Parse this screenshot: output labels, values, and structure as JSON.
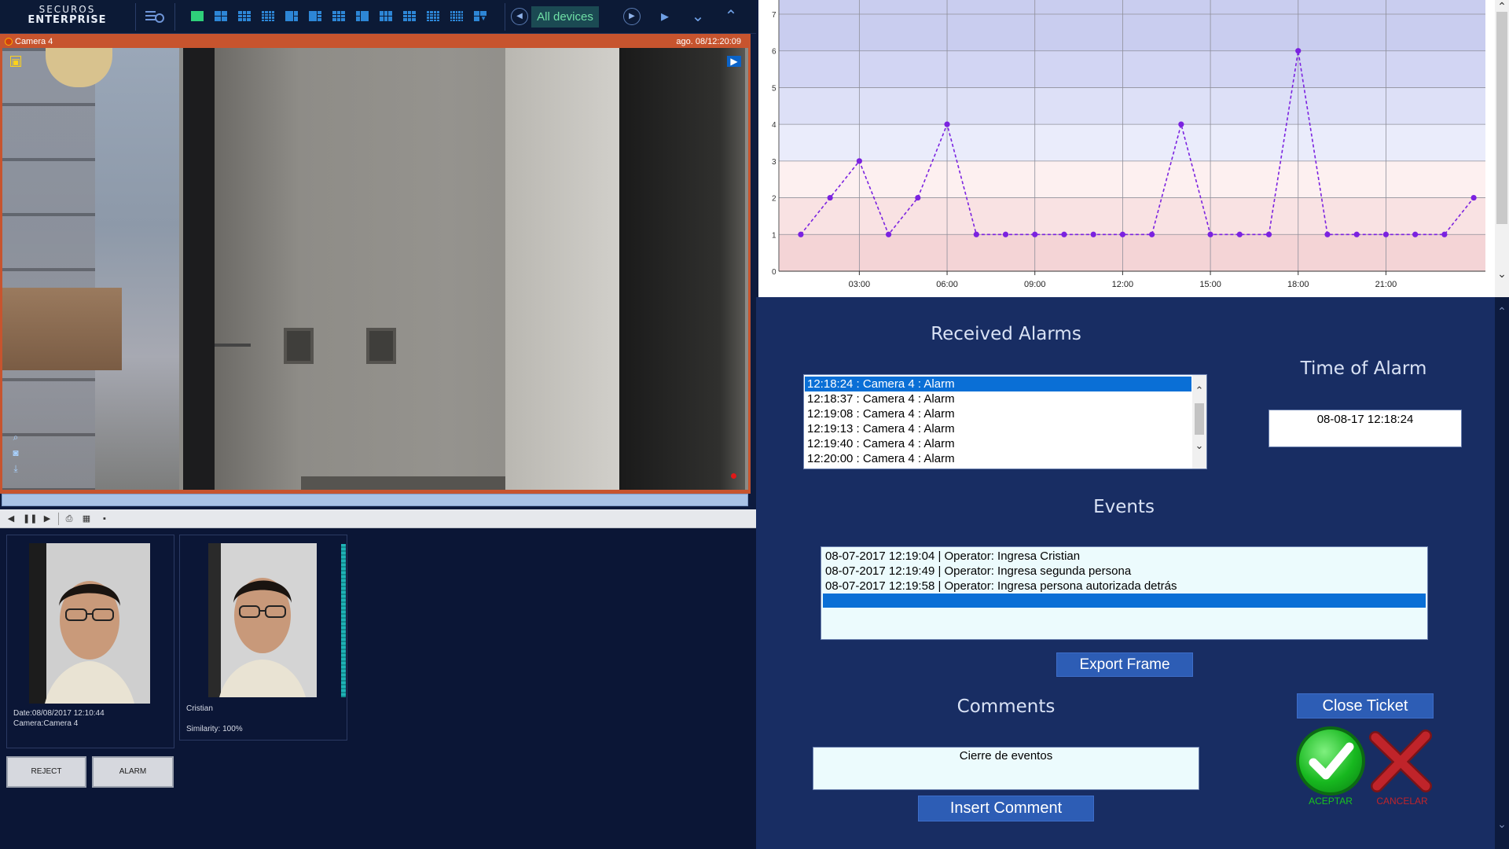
{
  "toolbar": {
    "brand_line1": "SECUROS",
    "brand_line2": "ENTERPRISE",
    "device_filter": "All devices"
  },
  "camera": {
    "name": "Camera 4",
    "timestamp": "ago. 08/12:20:09"
  },
  "face_results": {
    "detected": {
      "date": "Date:08/08/2017 12:10:44",
      "camera": "Camera:Camera 4"
    },
    "match": {
      "name": "Cristian",
      "similarity": "Similarity: 100%"
    },
    "reject_label": "REJECT",
    "alarm_label": "ALARM"
  },
  "chart_data": {
    "type": "line",
    "x_ticks": [
      "03:00",
      "06:00",
      "09:00",
      "12:00",
      "15:00",
      "18:00",
      "21:00"
    ],
    "y_ticks": [
      "0",
      "1",
      "2",
      "3",
      "4",
      "5",
      "6",
      "7"
    ],
    "ylim": [
      0,
      7
    ],
    "xlim_hours": [
      0.25,
      24.4
    ],
    "grid": true,
    "line_color": "#7b22e0",
    "band_colors": [
      "#f4d4d6",
      "#f9e2e3",
      "#fdf0f0",
      "#eaecfb",
      "#dde0f7",
      "#d2d5f3",
      "#c9cdef"
    ],
    "series": [
      {
        "x_hours": [
          1,
          2,
          3,
          4,
          5,
          6,
          7,
          8,
          9,
          10,
          11,
          12,
          13,
          14,
          15,
          16,
          17,
          18,
          19,
          20,
          21,
          22,
          23,
          24
        ],
        "values": [
          1,
          2,
          3,
          1,
          2,
          4,
          1,
          1,
          1,
          1,
          1,
          1,
          1,
          4,
          1,
          1,
          1,
          6,
          1,
          1,
          1,
          1,
          1,
          2
        ]
      }
    ]
  },
  "alarms": {
    "heading": "Received Alarms",
    "items": [
      "12:18:24 : Camera 4 : Alarm",
      "12:18:37 : Camera 4 : Alarm",
      "12:19:08 : Camera 4 : Alarm",
      "12:19:13 : Camera 4 : Alarm",
      "12:19:40 : Camera 4 : Alarm",
      "12:20:00 : Camera 4 : Alarm"
    ],
    "selected_index": 0
  },
  "time_of_alarm": {
    "heading": "Time of Alarm",
    "value": "08-08-17  12:18:24"
  },
  "events": {
    "heading": "Events",
    "items": [
      "08-07-2017 12:19:04 | Operator: Ingresa Cristian",
      "08-07-2017 12:19:49 | Operator: Ingresa segunda persona",
      "08-07-2017 12:19:58 | Operator: Ingresa persona autorizada detrás"
    ]
  },
  "buttons": {
    "export_frame": "Export Frame",
    "close_ticket": "Close Ticket",
    "insert_comment": "Insert Comment"
  },
  "comments": {
    "heading": "Comments",
    "value": "Cierre de eventos"
  },
  "actions": {
    "accept": "ACEPTAR",
    "cancel": "CANCELAR",
    "accept_color": "#19c31f",
    "cancel_color": "#c0242a"
  }
}
